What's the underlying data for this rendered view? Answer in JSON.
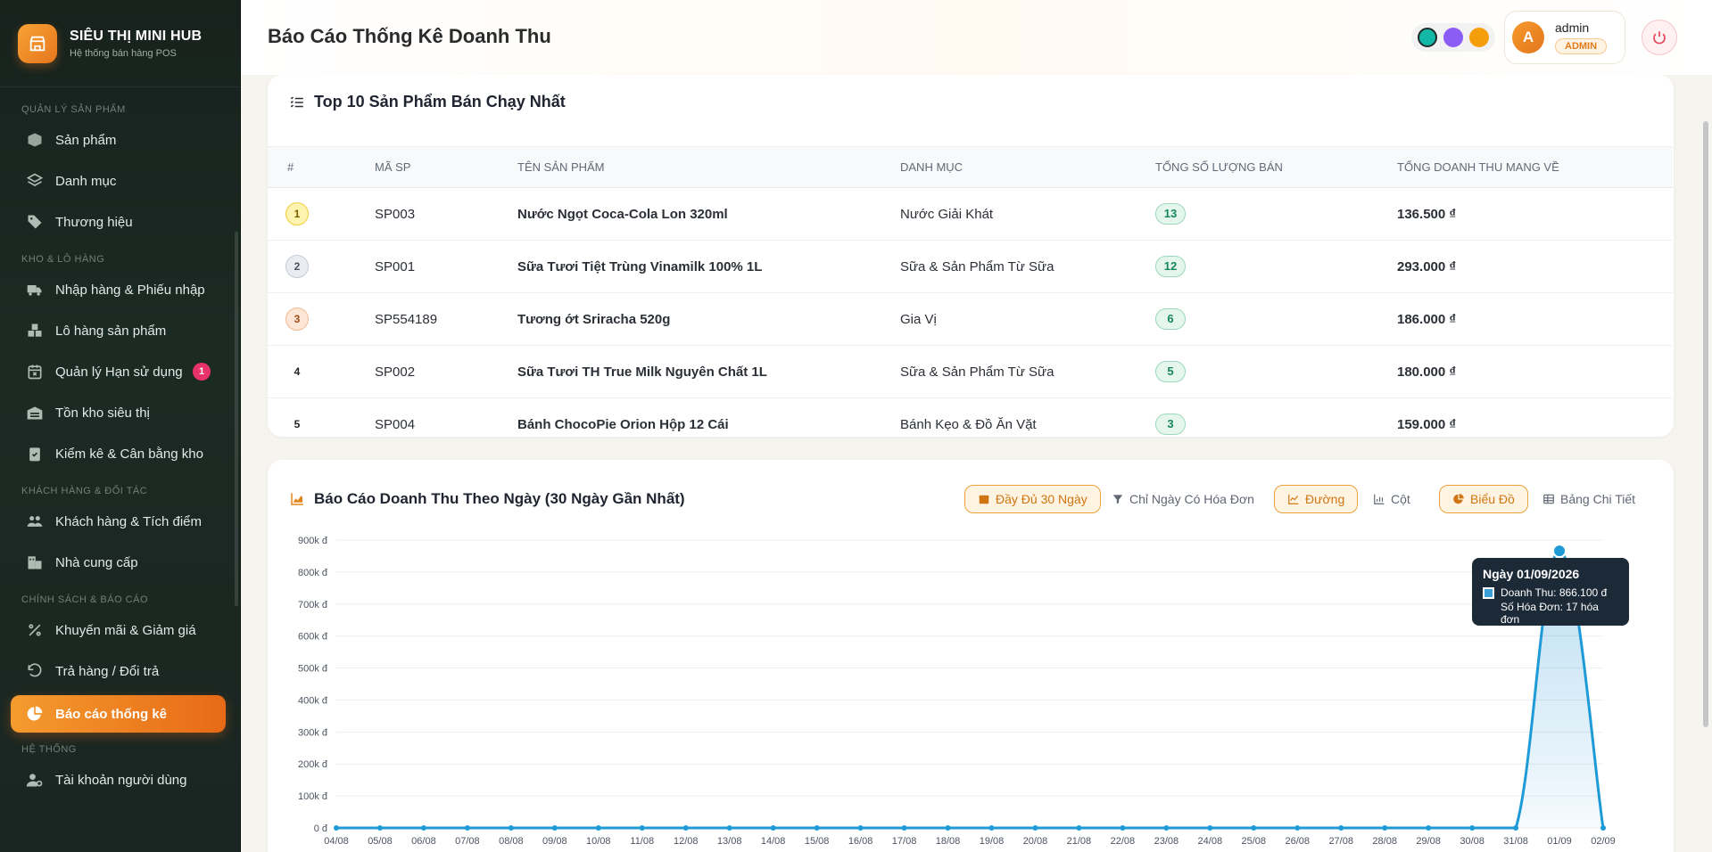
{
  "brand": {
    "title": "SIÊU THỊ MINI HUB",
    "subtitle": "Hệ thống bán hàng POS"
  },
  "sidebar": {
    "sections": [
      {
        "label": "QUẢN LÝ SẢN PHẨM",
        "items": [
          {
            "label": "Sản phẩm",
            "icon": "box-icon"
          },
          {
            "label": "Danh mục",
            "icon": "layers-icon"
          },
          {
            "label": "Thương hiệu",
            "icon": "tag-icon"
          }
        ]
      },
      {
        "label": "KHO & LÔ HÀNG",
        "items": [
          {
            "label": "Nhập hàng & Phiếu nhập",
            "icon": "truck-icon"
          },
          {
            "label": "Lô hàng sản phẩm",
            "icon": "boxes-icon"
          },
          {
            "label": "Quản lý Hạn sử dụng",
            "icon": "calendar-x-icon",
            "badge": "1"
          },
          {
            "label": "Tồn kho siêu thị",
            "icon": "warehouse-icon"
          },
          {
            "label": "Kiểm kê & Cân bằng kho",
            "icon": "clipboard-check-icon"
          }
        ]
      },
      {
        "label": "KHÁCH HÀNG & ĐỐI TÁC",
        "items": [
          {
            "label": "Khách hàng & Tích điểm",
            "icon": "users-icon"
          },
          {
            "label": "Nhà cung cấp",
            "icon": "building-icon"
          }
        ]
      },
      {
        "label": "CHÍNH SÁCH & BÁO CÁO",
        "items": [
          {
            "label": "Khuyến mãi & Giảm giá",
            "icon": "percent-icon"
          },
          {
            "label": "Trả hàng / Đổi trả",
            "icon": "undo-icon"
          },
          {
            "label": "Báo cáo thống kê",
            "icon": "pie-chart-icon",
            "active": true
          }
        ]
      },
      {
        "label": "HỆ THỐNG",
        "items": [
          {
            "label": "Tài khoản người dùng",
            "icon": "user-gear-icon"
          }
        ]
      }
    ]
  },
  "header": {
    "title": "Báo Cáo Thống Kê Doanh Thu",
    "theme_colors": [
      "#14b8a6",
      "#8b5cf6",
      "#f59e0b"
    ],
    "user": {
      "avatar": "A",
      "name": "admin",
      "role": "ADMIN"
    }
  },
  "top_products": {
    "title": "Top 10 Sản Phẩm Bán Chạy Nhất",
    "columns": [
      "#",
      "MÃ SP",
      "TÊN SẢN PHẨM",
      "DANH MỤC",
      "TỔNG SỐ LƯỢNG BÁN",
      "TỔNG DOANH THU MANG VỀ"
    ],
    "rows": [
      {
        "rank": "1",
        "code": "SP003",
        "name": "Nước Ngọt Coca-Cola Lon 320ml",
        "category": "Nước Giải Khát",
        "qty": "13",
        "revenue": "136.500 ₫"
      },
      {
        "rank": "2",
        "code": "SP001",
        "name": "Sữa Tươi Tiệt Trùng Vinamilk 100% 1L",
        "category": "Sữa & Sản Phẩm Từ Sữa",
        "qty": "12",
        "revenue": "293.000 ₫"
      },
      {
        "rank": "3",
        "code": "SP554189",
        "name": "Tương ớt Sriracha 520g",
        "category": "Gia Vị",
        "qty": "6",
        "revenue": "186.000 ₫"
      },
      {
        "rank": "4",
        "code": "SP002",
        "name": "Sữa Tươi TH True Milk Nguyên Chất 1L",
        "category": "Sữa & Sản Phẩm Từ Sữa",
        "qty": "5",
        "revenue": "180.000 ₫"
      },
      {
        "rank": "5",
        "code": "SP004",
        "name": "Bánh ChocoPie Orion Hộp 12 Cái",
        "category": "Bánh Kẹo & Đồ Ăn Vặt",
        "qty": "3",
        "revenue": "159.000 ₫"
      }
    ]
  },
  "revenue_card": {
    "title": "Báo Cáo Doanh Thu Theo Ngày (30 Ngày Gần Nhất)",
    "controls": {
      "full30": "Đầy Đủ 30 Ngày",
      "only_invoice": "Chỉ Ngày Có Hóa Đơn",
      "line": "Đường",
      "bar": "Cột",
      "chart": "Biểu Đồ",
      "table": "Bảng Chi Tiết"
    },
    "tooltip": {
      "title": "Ngày 01/09/2026",
      "revenue": "Doanh Thu: 866.100 đ",
      "invoices": "Số Hóa Đơn: 17 hóa đơn"
    }
  },
  "chart_data": {
    "type": "area",
    "title": "",
    "xlabel": "",
    "ylabel": "",
    "ylim": [
      0,
      900000
    ],
    "y_ticks": [
      0,
      100000,
      200000,
      300000,
      400000,
      500000,
      600000,
      700000,
      800000,
      900000
    ],
    "y_tick_labels": [
      "0 đ",
      "100k đ",
      "200k đ",
      "300k đ",
      "400k đ",
      "500k đ",
      "600k đ",
      "700k đ",
      "800k đ",
      "900k đ"
    ],
    "grid": true,
    "line_color": "#1e9bd7",
    "x": [
      "04/08",
      "05/08",
      "06/08",
      "07/08",
      "08/08",
      "09/08",
      "10/08",
      "11/08",
      "12/08",
      "13/08",
      "14/08",
      "15/08",
      "16/08",
      "17/08",
      "18/08",
      "19/08",
      "20/08",
      "21/08",
      "22/08",
      "23/08",
      "24/08",
      "25/08",
      "26/08",
      "27/08",
      "28/08",
      "29/08",
      "30/08",
      "31/08",
      "01/09",
      "02/09"
    ],
    "series": [
      {
        "values": [
          0,
          0,
          0,
          0,
          0,
          0,
          0,
          0,
          0,
          0,
          0,
          0,
          0,
          0,
          0,
          0,
          0,
          0,
          0,
          0,
          0,
          0,
          0,
          0,
          0,
          0,
          0,
          0,
          866100,
          0
        ]
      }
    ],
    "highlight_index": 28
  }
}
